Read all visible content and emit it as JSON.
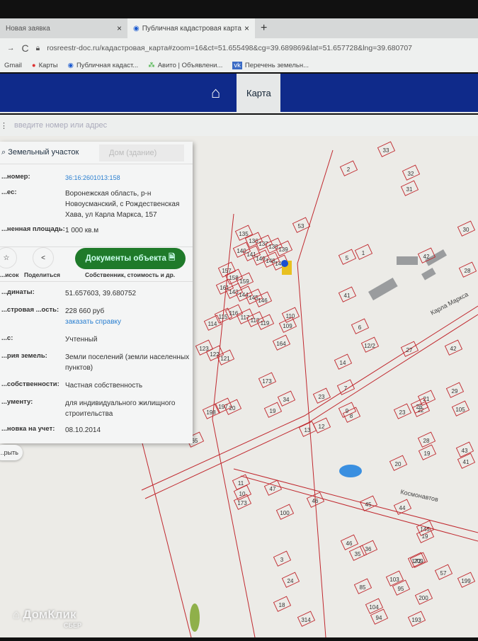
{
  "browser": {
    "tabs": [
      {
        "label": "Новая заявка"
      },
      {
        "label": "Публичная кадастровая карта"
      }
    ],
    "url": "rosreestr-doc.ru/кадастровая_карта#zoom=16&ct=51.655498&cg=39.689869&lat=51.657728&lng=39.680707",
    "bookmarks": [
      {
        "label": "Gmail"
      },
      {
        "label": "Карты"
      },
      {
        "label": "Публичная кадаст..."
      },
      {
        "label": "Авито | Объявлени..."
      },
      {
        "label": "Перечень земельн..."
      }
    ]
  },
  "header": {
    "nav_label": "Карта"
  },
  "search": {
    "placeholder": "введите номер или адрес"
  },
  "panel": {
    "tab_land": "Земельный участок",
    "tab_house": "Дом (здание)",
    "rows": [
      {
        "k": "...номер:",
        "v": "36:16:2601013:158"
      },
      {
        "k": "...ес:",
        "v": "Воронежская область, р-н Новоусманский, с Рождественская Хава, ул Карла Маркса, 157"
      },
      {
        "k": "...ненная площадь:",
        "v": "1 000 кв.м"
      },
      {
        "k": "...динаты:",
        "v": "51.657603, 39.680752"
      },
      {
        "k": "...стровая ...ость:",
        "v": "228 660 руб"
      },
      {
        "k": "...с:",
        "v": "Учтенный"
      },
      {
        "k": "...рия земель:",
        "v": "Земли поселений (земли населенных пунктов)"
      },
      {
        "k": "...собственности:",
        "v": "Частная собственность"
      },
      {
        "k": "...ументу:",
        "v": "для индивидуального жилищного строительства"
      },
      {
        "k": "...новка на учет:",
        "v": "08.10.2014"
      }
    ],
    "order_link": "заказать справку",
    "list_label": "...исок",
    "share_label": "Поделиться",
    "docs_button": "Документы объекта",
    "docs_sub": "Собственник, стоимость и др.",
    "open_button": "...рыть"
  },
  "map": {
    "streets": [
      "Карла Маркса",
      "Космонавтов"
    ],
    "parcels": [
      "53",
      "135",
      "136",
      "137",
      "138",
      "139",
      "140",
      "141",
      "149",
      "148",
      "147",
      "157",
      "158",
      "159",
      "161",
      "143",
      "144",
      "145",
      "146",
      "114",
      "115",
      "116",
      "117",
      "118",
      "119",
      "110",
      "109",
      "164",
      "123",
      "122",
      "121",
      "173",
      "198",
      "197",
      "65",
      "20",
      "19",
      "34",
      "13",
      "12",
      "11",
      "10",
      "173",
      "47",
      "46",
      "45",
      "44",
      "145",
      "100",
      "42",
      "41",
      "28",
      "30",
      "31",
      "32",
      "33",
      "2",
      "1",
      "5",
      "6",
      "12/2",
      "27",
      "14",
      "21",
      "22",
      "23",
      "26",
      "28",
      "19",
      "20",
      "29",
      "105",
      "41",
      "43",
      "42",
      "46",
      "36",
      "35",
      "85",
      "103",
      "95",
      "200",
      "199",
      "57",
      "94",
      "104",
      "193",
      "314",
      "3",
      "24",
      "18",
      "19",
      "23",
      "7",
      "8",
      "9",
      "172",
      "209"
    ]
  },
  "watermark": {
    "brand": "ДомКлик",
    "sub": "СБЕР"
  },
  "colors": {
    "header": "#0f2a8a",
    "parcel_line": "#c0282e",
    "docs_button": "#1f7a2a",
    "link": "#2a7fd0"
  }
}
